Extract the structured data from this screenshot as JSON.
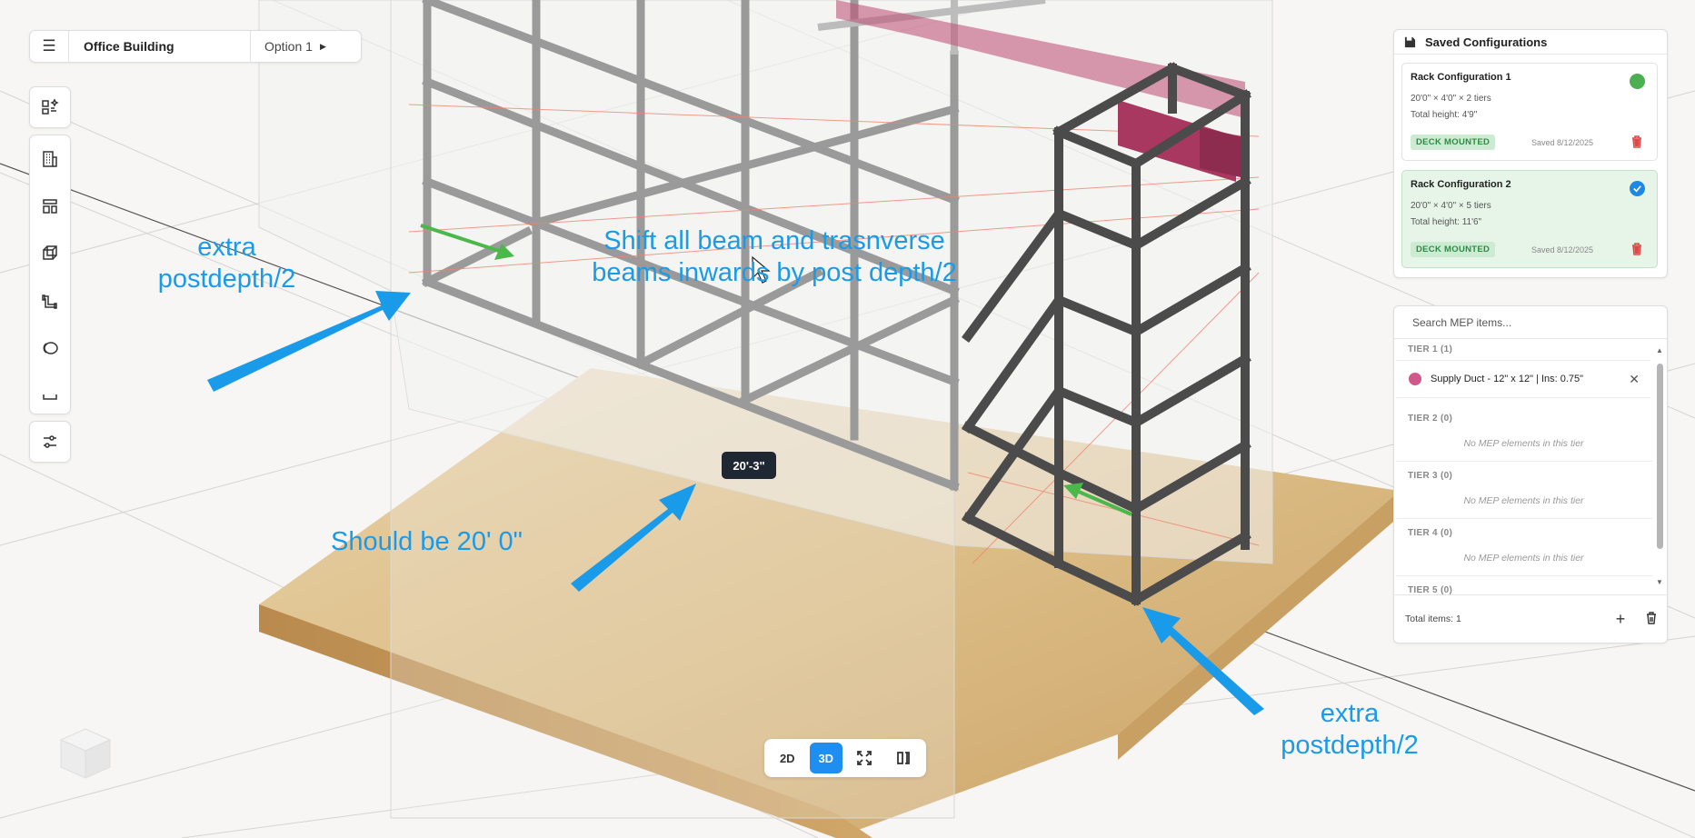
{
  "topbar": {
    "menu_icon": "hamburger-icon",
    "project": "Office Building",
    "option": "Option 1"
  },
  "toolbar": {
    "tools": [
      "ai-layout-icon",
      "building-icon",
      "layout-icon",
      "3d-box-icon",
      "pipe-icon",
      "ring-icon",
      "tray-icon"
    ],
    "settings": "sliders-icon"
  },
  "viewcontrols": {
    "btn_2d": "2D",
    "btn_3d": "3D",
    "active": "3D",
    "fullscreen": "fullscreen-icon",
    "split": "split-view-icon"
  },
  "dimension": "20'-3\"",
  "annotations": {
    "left_line1": "extra",
    "left_line2": "postdepth/2",
    "center_line1": "Shift all beam and trasnverse",
    "center_line2": "beams inwards by post depth/2",
    "bottom": "Should be 20' 0\"",
    "right_line1": "extra",
    "right_line2": "postdepth/2"
  },
  "saved": {
    "title": "Saved Configurations",
    "configs": [
      {
        "name": "Rack Configuration 1",
        "dims": "20'0\" × 4'0\" × 2 tiers",
        "height": "Total height: 4'9\"",
        "badge": "DECK MOUNTED",
        "date": "Saved 8/12/2025",
        "status": "green"
      },
      {
        "name": "Rack Configuration 2",
        "dims": "20'0\" × 4'0\" × 5 tiers",
        "height": "Total height: 11'6\"",
        "badge": "DECK MOUNTED",
        "date": "Saved 8/12/2025",
        "status": "selected"
      }
    ]
  },
  "mep": {
    "search_placeholder": "Search MEP items...",
    "tiers": [
      {
        "title": "TIER 1 (1)",
        "item": "Supply Duct - 12\" x 12\" | Ins: 0.75\""
      },
      {
        "title": "TIER 2 (0)",
        "empty": "No MEP elements in this tier"
      },
      {
        "title": "TIER 3 (0)",
        "empty": "No MEP elements in this tier"
      },
      {
        "title": "TIER 4 (0)",
        "empty": "No MEP elements in this tier"
      },
      {
        "title": "TIER 5 (0)"
      }
    ],
    "total": "Total items: 1"
  },
  "colors": {
    "accent": "#1e8ef0",
    "annotation": "#1a9bea",
    "green_arrow": "#4ab84a",
    "duct": "#c0557a",
    "wood": "#d9b880"
  }
}
